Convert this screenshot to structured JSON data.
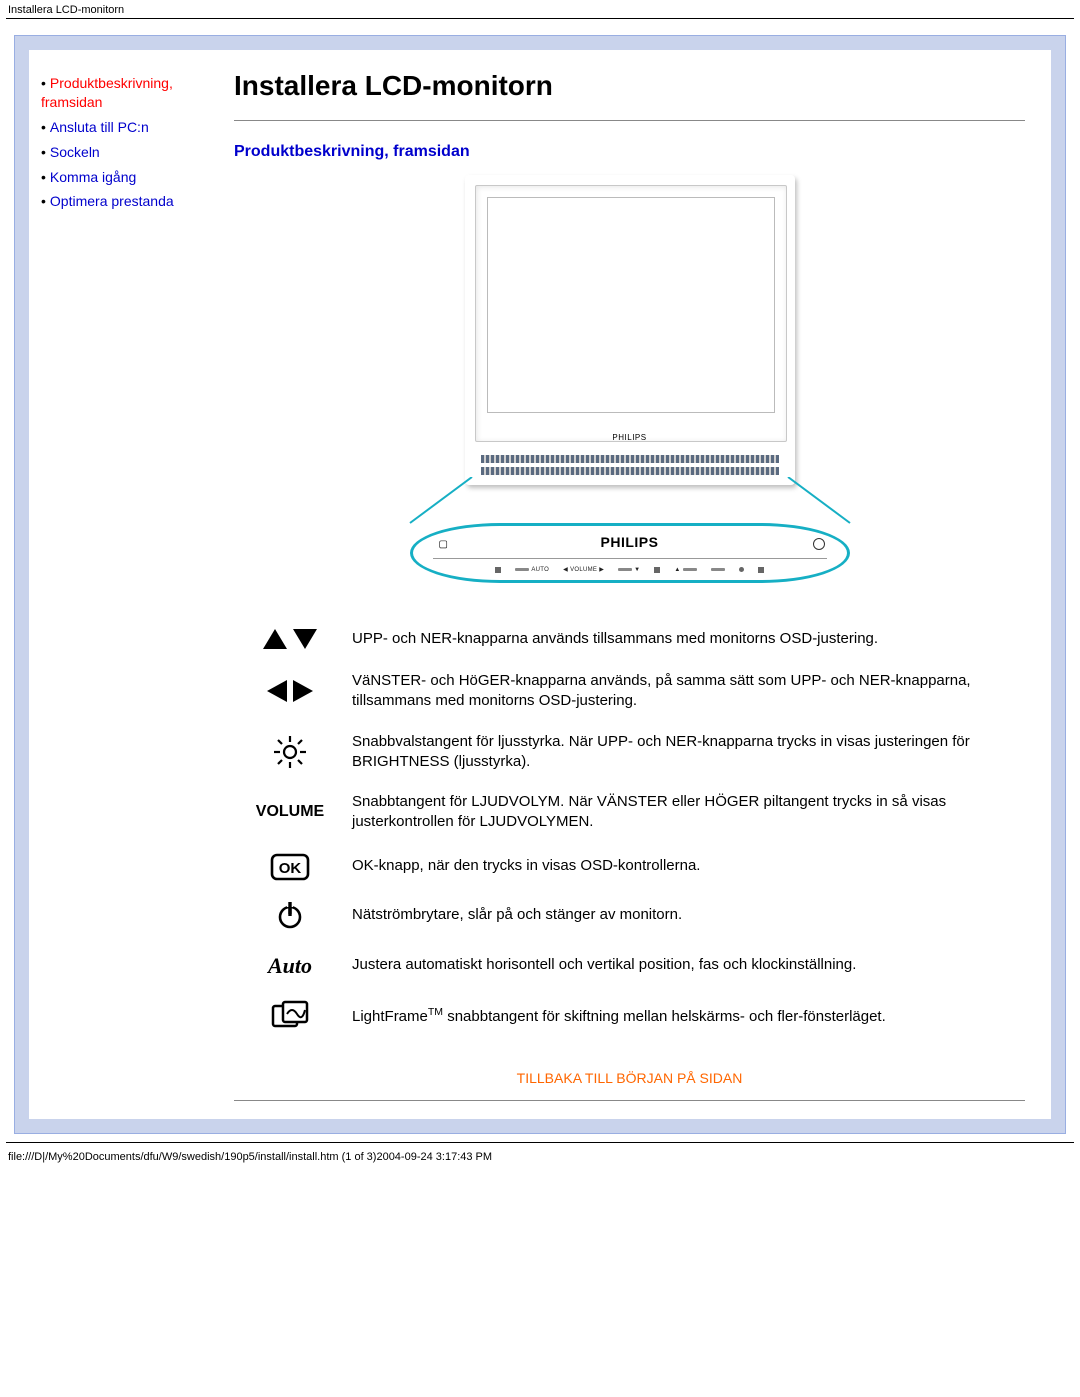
{
  "header_path": "Installera LCD-monitorn",
  "nav": {
    "items": [
      {
        "label": "Produktbeskrivning, framsidan",
        "current": true
      },
      {
        "label": "Ansluta till PC:n"
      },
      {
        "label": "Sockeln"
      },
      {
        "label": "Komma igång"
      },
      {
        "label": "Optimera prestanda"
      }
    ]
  },
  "main": {
    "page_title": "Installera LCD-monitorn",
    "section_title": "Produktbeskrivning, framsidan",
    "monitor": {
      "brand_small": "PHILIPS",
      "panel_brand": "PHILIPS",
      "panel_labels": {
        "auto": "AUTO",
        "volume": "VOLUME"
      }
    },
    "rows": [
      {
        "icon": "up-down",
        "text": "UPP- och NER-knapparna används tillsammans med monitorns OSD-justering."
      },
      {
        "icon": "left-right",
        "text": "VäNSTER- och HöGER-knapparna används, på samma sätt som UPP- och NER-knapparna, tillsammans med monitorns OSD-justering."
      },
      {
        "icon": "brightness",
        "text": "Snabbvalstangent för ljusstyrka. När UPP- och NER-knapparna trycks in visas justeringen för BRIGHTNESS (ljusstyrka)."
      },
      {
        "icon": "volume",
        "icon_text": "VOLUME",
        "text": "Snabbtangent för LJUDVOLYM. När VÄNSTER eller HÖGER piltangent trycks in så visas justerkontrollen för LJUDVOLYMEN."
      },
      {
        "icon": "ok",
        "text": "OK-knapp, när den trycks in visas OSD-kontrollerna."
      },
      {
        "icon": "power",
        "text": "Nätströmbrytare, slår på och stänger av monitorn."
      },
      {
        "icon": "auto",
        "icon_text": "Auto",
        "text": "Justera automatiskt horisontell och vertikal position, fas och klockinställning."
      },
      {
        "icon": "lightframe",
        "text_prefix": "LightFrame",
        "text_super": "TM",
        "text_suffix": " snabbtangent för skiftning mellan helskärms- och fler-fönsterläget."
      }
    ],
    "back_to_top": "TILLBAKA TILL BÖRJAN PÅ SIDAN"
  },
  "footer_line": "file:///D|/My%20Documents/dfu/W9/swedish/190p5/install/install.htm (1 of 3)2004-09-24 3:17:43 PM"
}
